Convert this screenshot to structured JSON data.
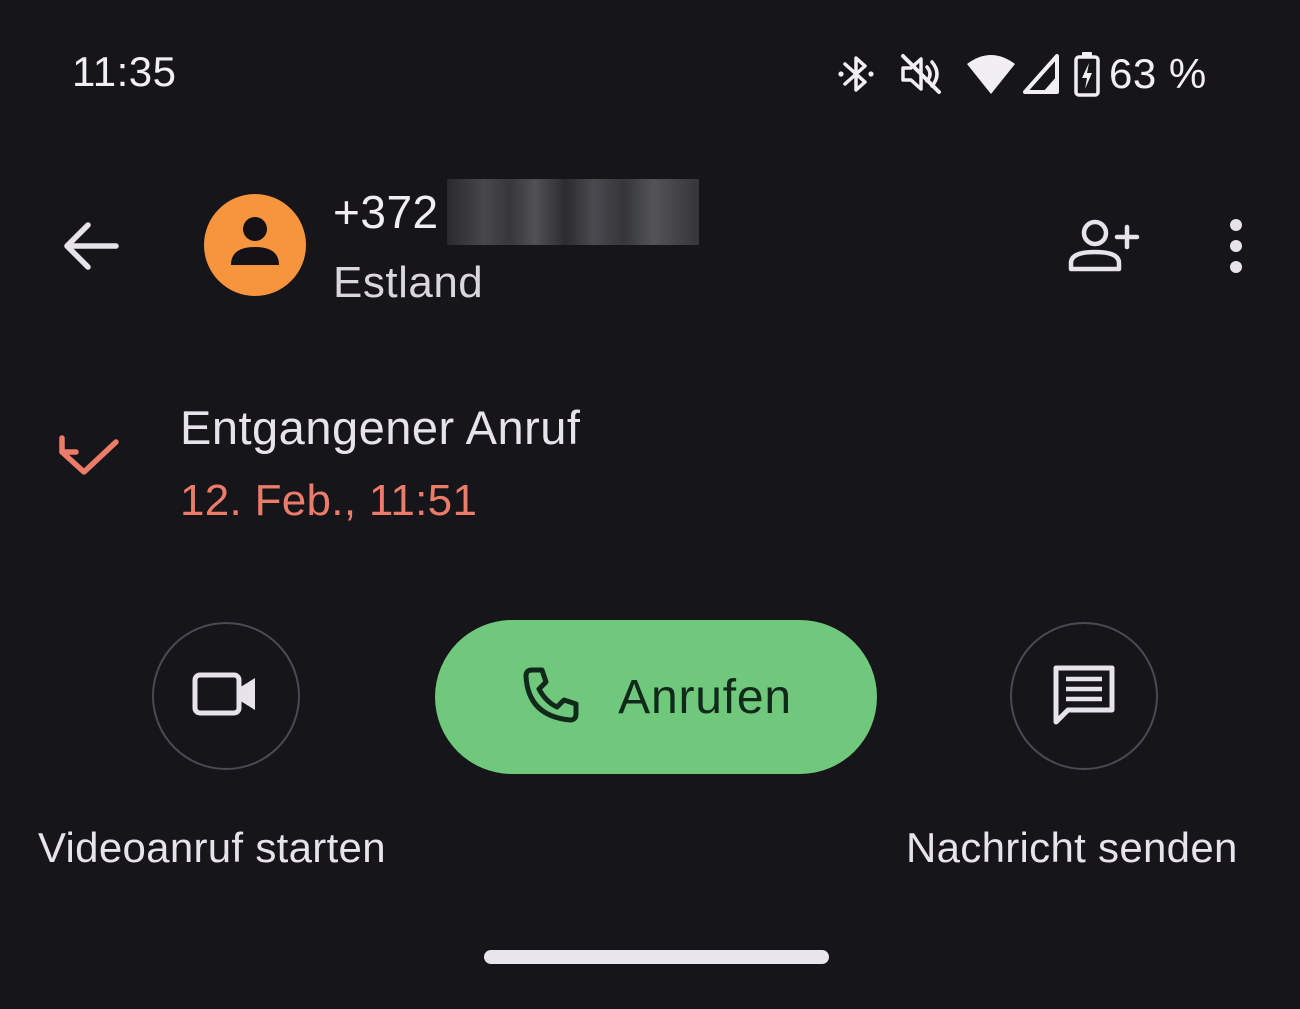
{
  "status_bar": {
    "time": "11:35",
    "battery_percent": "63 %",
    "icons": [
      "bluetooth-icon",
      "mute-icon",
      "wifi-icon",
      "signal-icon",
      "battery-charging-icon"
    ]
  },
  "header": {
    "back_icon": "arrow-left-icon",
    "avatar_icon": "person-icon",
    "avatar_color": "#f7953f",
    "phone_number_prefix": "+372",
    "country": "Estland",
    "add_contact_icon": "person-add-icon",
    "more_icon": "more-vertical-icon"
  },
  "call_entry": {
    "icon": "missed-call-icon",
    "type": "Entgangener Anruf",
    "timestamp": "12. Feb., 11:51",
    "accent_color": "#ec7b6a"
  },
  "actions": {
    "video": {
      "icon": "videocam-icon",
      "label": "Videoanruf starten"
    },
    "call": {
      "icon": "phone-icon",
      "label": "Anrufen",
      "color": "#6fc87b"
    },
    "message": {
      "icon": "message-icon",
      "label": "Nachricht senden"
    }
  }
}
